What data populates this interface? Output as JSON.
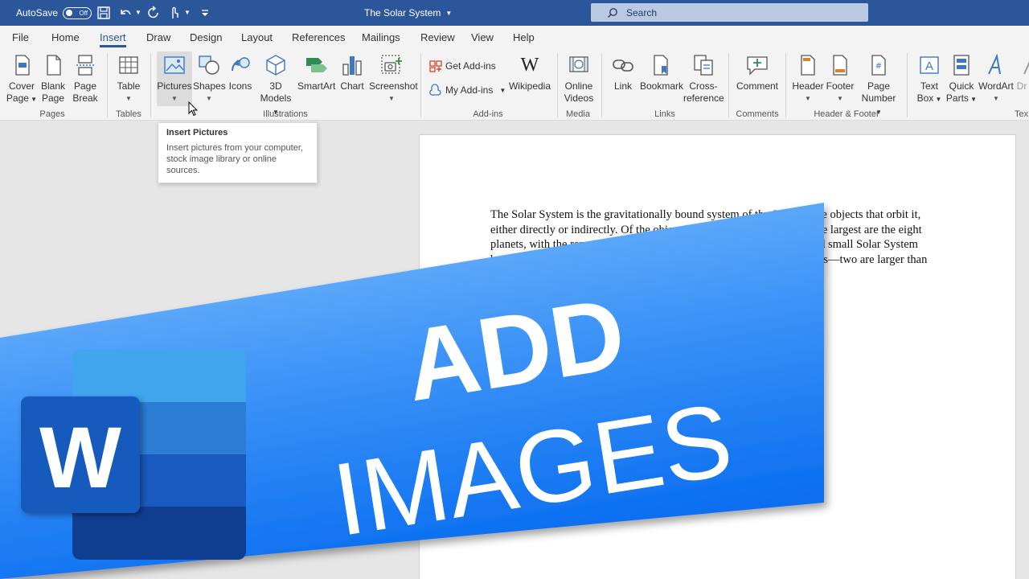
{
  "titlebar": {
    "autosave_label": "AutoSave",
    "autosave_state": "Off",
    "doc_title": "The Solar System",
    "search_placeholder": "Search"
  },
  "tabs": [
    {
      "label": "File"
    },
    {
      "label": "Home"
    },
    {
      "label": "Insert",
      "active": true
    },
    {
      "label": "Draw"
    },
    {
      "label": "Design"
    },
    {
      "label": "Layout"
    },
    {
      "label": "References"
    },
    {
      "label": "Mailings"
    },
    {
      "label": "Review"
    },
    {
      "label": "View"
    },
    {
      "label": "Help"
    }
  ],
  "ribbon": {
    "cover_page": [
      "Cover",
      "Page"
    ],
    "blank_page": [
      "Blank",
      "Page"
    ],
    "page_break": [
      "Page",
      "Break"
    ],
    "table": "Table",
    "pictures": "Pictures",
    "shapes": "Shapes",
    "icons": "Icons",
    "models": [
      "3D",
      "Models"
    ],
    "smartart": "SmartArt",
    "chart": "Chart",
    "screenshot": "Screenshot",
    "get_addins": "Get Add-ins",
    "my_addins": "My Add-ins",
    "wikipedia": "Wikipedia",
    "online_videos": [
      "Online",
      "Videos"
    ],
    "link": "Link",
    "bookmark": "Bookmark",
    "cross_reference": [
      "Cross-",
      "reference"
    ],
    "comment": "Comment",
    "header": "Header",
    "footer": "Footer",
    "page_number": [
      "Page",
      "Number"
    ],
    "text_box": [
      "Text",
      "Box"
    ],
    "quick_parts": [
      "Quick",
      "Parts"
    ],
    "wordart": "WordArt",
    "drop_cap_partial": "Dr",
    "groups": {
      "pages": "Pages",
      "tables": "Tables",
      "illustrations": "Illustrations",
      "addins": "Add-ins",
      "media": "Media",
      "links": "Links",
      "comments": "Comments",
      "header_footer": "Header & Footer",
      "text_partial": "Tex"
    }
  },
  "tooltip": {
    "title": "Insert Pictures",
    "body": "Insert pictures from your computer, stock image library or online sources."
  },
  "document": {
    "lines": [
      "The Solar System is the gravitationally bound system of the Sun and the objects that orbit it,",
      "either directly or indirectly. Of the objects that orbit the Sun directly, the largest are the eight",
      "planets, with the remainder being smaller objects, the dwarf planets and small Solar System",
      "bodies. Of the objects that orbit the Sun indirectly—the natural satellites—two are larger than"
    ]
  },
  "banner": {
    "line1": "ADD",
    "line2": "IMAGES",
    "logo_letter": "W",
    "colors": {
      "light": "#7fbcff",
      "dark": "#0a6df0",
      "word_blue": "#185abd"
    }
  }
}
